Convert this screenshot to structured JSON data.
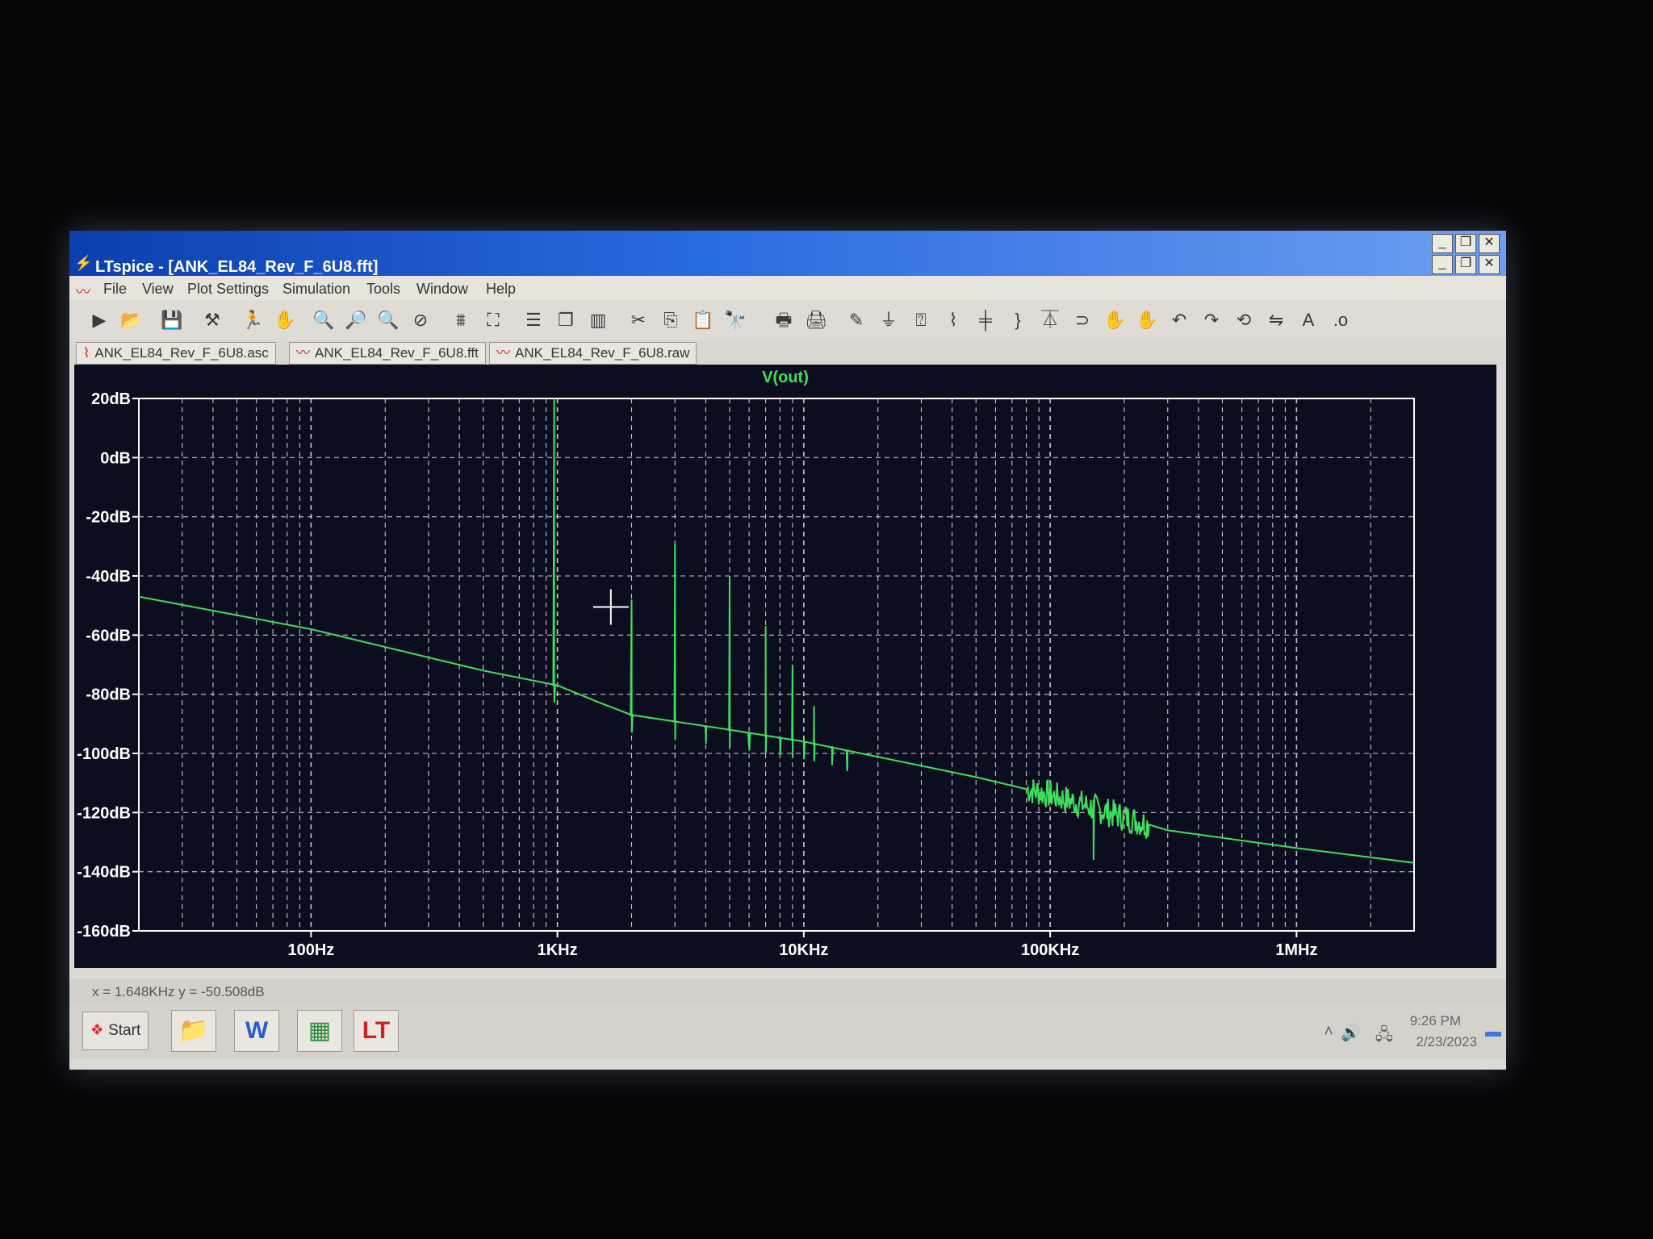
{
  "window": {
    "title": "LTspice - [ANK_EL84_Rev_F_6U8.fft]",
    "controls": [
      "_",
      "❐",
      "✕"
    ]
  },
  "menu": [
    "File",
    "View",
    "Plot Settings",
    "Simulation",
    "Tools",
    "Window",
    "Help"
  ],
  "toolbar_icons": [
    "run-icon",
    "open-icon",
    "save-icon",
    "control-panel-icon",
    "run-man-icon",
    "pan-hand-icon",
    "zoom-in-icon",
    "zoom-area-icon",
    "zoom-out-icon",
    "zoom-cancel-icon",
    "autorange-icon",
    "full-view-icon",
    "tile-horizontal-icon",
    "cascade-icon",
    "tile-vertical-icon",
    "cut-icon",
    "copy-icon",
    "paste-icon",
    "find-icon",
    "print-icon",
    "print-setup-icon",
    "draw-wire-icon",
    "ground-icon",
    "label-icon",
    "resistor-icon",
    "capacitor-icon",
    "inductor-icon",
    "diode-icon",
    "component-icon",
    "move-icon",
    "drag-icon",
    "undo-icon",
    "redo-icon",
    "rotate-icon",
    "mirror-icon",
    "text-icon",
    "spice-directive-icon"
  ],
  "tabs": [
    {
      "label": "ANK_EL84_Rev_F_6U8.asc"
    },
    {
      "label": "ANK_EL84_Rev_F_6U8.fft"
    },
    {
      "label": "ANK_EL84_Rev_F_6U8.raw"
    }
  ],
  "chart_data": {
    "type": "line",
    "title": "V(out)",
    "x_scale": "log",
    "xlim": [
      20,
      3000000
    ],
    "ylim": [
      -160,
      20
    ],
    "yticks": [
      "20dB",
      "0dB",
      "-20dB",
      "-40dB",
      "-60dB",
      "-80dB",
      "-100dB",
      "-120dB",
      "-140dB",
      "-160dB"
    ],
    "xticks": [
      "100Hz",
      "1KHz",
      "10KHz",
      "100KHz",
      "1MHz"
    ],
    "grid": true,
    "colors": {
      "trace": "#3fe060",
      "grid": "#c8c8d0",
      "background": "#0c0e20",
      "title": "#3fe060"
    },
    "series": [
      {
        "baseline": [
          [
            20,
            -47
          ],
          [
            100,
            -58
          ],
          [
            500,
            -72
          ],
          [
            1000,
            -77
          ],
          [
            1500,
            -83
          ],
          [
            2000,
            -87
          ],
          [
            5000,
            -92
          ],
          [
            10000,
            -96
          ],
          [
            50000,
            -108
          ],
          [
            100000,
            -114
          ],
          [
            300000,
            -126
          ],
          [
            1000000,
            -132
          ],
          [
            3000000,
            -137
          ]
        ],
        "spikes": [
          [
            970,
            20
          ],
          [
            2000,
            -48
          ],
          [
            3000,
            -29
          ],
          [
            4000,
            -93
          ],
          [
            5000,
            -40
          ],
          [
            6000,
            -98
          ],
          [
            7000,
            -57
          ],
          [
            8000,
            -95
          ],
          [
            9000,
            -70
          ],
          [
            10000,
            -97
          ],
          [
            11000,
            -84
          ],
          [
            13000,
            -98
          ],
          [
            15000,
            -106
          ]
        ],
        "noise_band": {
          "from": 80000,
          "to": 250000,
          "amplitude": 5,
          "dip": [
            150000,
            -136
          ]
        }
      }
    ]
  },
  "cursor": {
    "x_hz": 1648,
    "y_db": -50.508
  },
  "status": {
    "cursor_readout": "x = 1.648KHz    y = -50.508dB"
  },
  "taskbar": {
    "start_label": "Start",
    "apps": [
      "folder-icon",
      "word-icon",
      "spreadsheet-icon",
      "ltspice-icon"
    ],
    "time": "9:26 PM",
    "date": "2/23/2023"
  }
}
